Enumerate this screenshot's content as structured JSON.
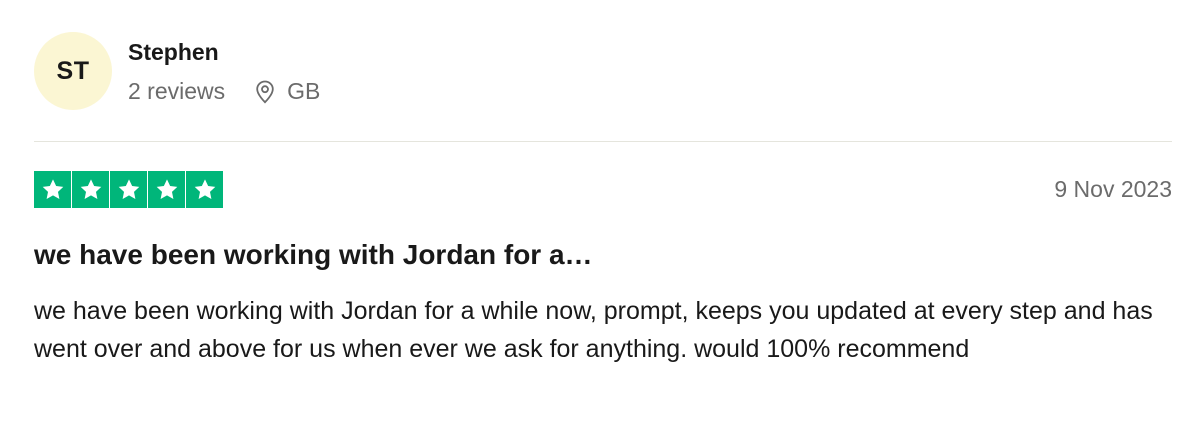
{
  "consumer": {
    "initials": "ST",
    "name": "Stephen",
    "reviews_count": "2 reviews",
    "country": "GB",
    "avatar_color": "#fbf6d3",
    "location_icon": "location-pin-icon"
  },
  "review": {
    "rating": 5,
    "max_rating": 5,
    "star_color": "#00b67a",
    "date": "9 Nov 2023",
    "title": "we have been working with Jordan for a…",
    "body": "we have been working with Jordan for a while now, prompt, keeps you updated at every step and has went over and above for us when ever we ask for anything. would 100% recommend"
  }
}
